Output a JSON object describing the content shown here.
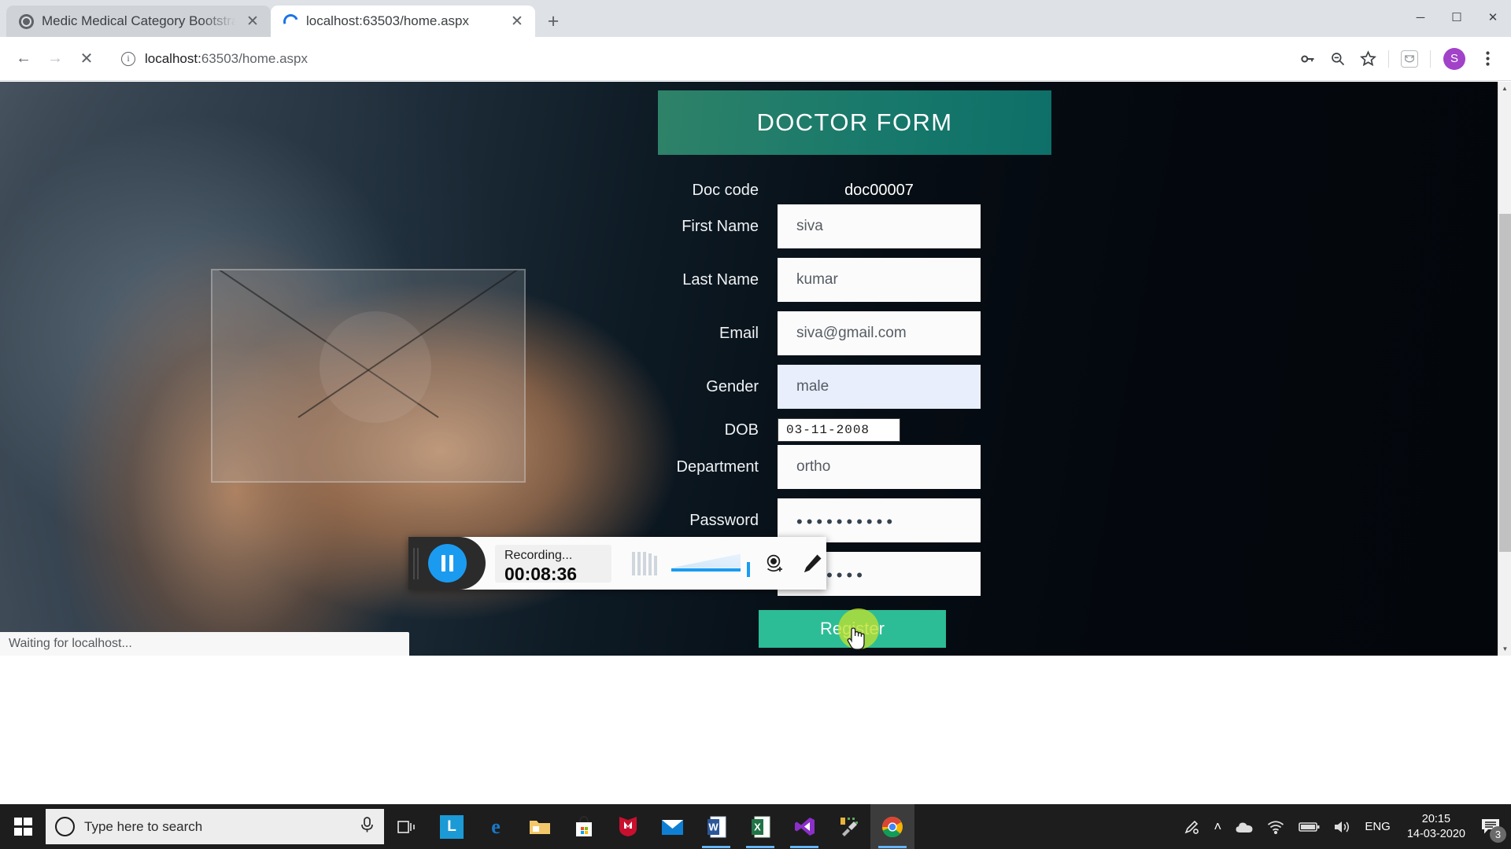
{
  "browser": {
    "tabs": [
      {
        "title": "Medic Medical Category Bootstra",
        "favicon": "globe-icon",
        "active": false,
        "close_label": "✕"
      },
      {
        "title": "localhost:63503/home.aspx",
        "favicon": "loading-spinner-icon",
        "active": true,
        "close_label": "✕"
      }
    ],
    "new_tab_label": "+",
    "window_controls": {
      "minimize": "─",
      "maximize": "☐",
      "close": "✕"
    },
    "nav": {
      "back": "←",
      "forward": "→",
      "stop": "✕"
    },
    "omnibox": {
      "scheme_prefix": "localhost:",
      "url_rest": "63503/home.aspx",
      "full_url": "localhost:63503/home.aspx",
      "info_icon_label": "i"
    },
    "toolbar_icons": [
      "key-icon",
      "zoom-out-icon",
      "star-bookmark-icon",
      "extension-icon",
      "profile-avatar",
      "three-dot-menu-icon"
    ],
    "profile_initial": "S"
  },
  "page": {
    "form": {
      "title": "DOCTOR FORM",
      "rows": [
        {
          "label": "Doc code",
          "type": "static",
          "value": "doc00007"
        },
        {
          "label": "First Name",
          "type": "text",
          "value": "siva"
        },
        {
          "label": "Last Name",
          "type": "text",
          "value": "kumar"
        },
        {
          "label": "Email",
          "type": "text",
          "value": "siva@gmail.com"
        },
        {
          "label": "Gender",
          "type": "autofill",
          "value": "male"
        },
        {
          "label": "DOB",
          "type": "date",
          "value": "03-11-2008"
        },
        {
          "label": "Department",
          "type": "text",
          "value": "ortho"
        },
        {
          "label": "Password",
          "type": "password",
          "value": "••••••••••"
        },
        {
          "label": "",
          "type": "password",
          "value": "•••••••"
        }
      ],
      "submit_label": "Register"
    },
    "colors": {
      "header_green_from": "#2e8268",
      "header_green_to": "#0d6f68",
      "button_green": "#2cbd96",
      "autofill_blue": "#e8eefc",
      "click_flash": "#bee030"
    },
    "status_text": "Waiting for localhost..."
  },
  "recorder": {
    "pause_label": "pause-icon",
    "status_label": "Recording...",
    "elapsed": "00:08:36",
    "icons": [
      "audio-level-bars-icon",
      "volume-slider",
      "webcam-add-icon",
      "pencil-draw-icon"
    ]
  },
  "taskbar": {
    "start_label": "windows-start-icon",
    "search_placeholder": "Type here to search",
    "mic_icon": "microphone-icon",
    "task_view_icon": "task-view-icon",
    "apps": [
      {
        "name": "lightshot-app-icon",
        "glyph": "L",
        "color": "#ffffff",
        "bg": "#1b9ad6",
        "running": false
      },
      {
        "name": "edge-browser-icon",
        "glyph": "e",
        "color": "#0f6cbd",
        "bg": "transparent",
        "running": false
      },
      {
        "name": "file-explorer-icon",
        "glyph": "▤",
        "color": "#f5c24a",
        "bg": "transparent",
        "running": false
      },
      {
        "name": "microsoft-store-icon",
        "glyph": "⊞",
        "color": "#ffffff",
        "bg": "#f3f3f3",
        "running": false
      },
      {
        "name": "mcafee-icon",
        "glyph": "M",
        "color": "#ffffff",
        "bg": "#c8102e",
        "running": false
      },
      {
        "name": "mail-icon",
        "glyph": "✉",
        "color": "#ffffff",
        "bg": "#0f7fd4",
        "running": false
      },
      {
        "name": "word-icon",
        "glyph": "W",
        "color": "#2b579a",
        "bg": "#ffffff",
        "running": true
      },
      {
        "name": "excel-icon",
        "glyph": "X",
        "color": "#217346",
        "bg": "#ffffff",
        "running": true
      },
      {
        "name": "visual-studio-icon",
        "glyph": "∞",
        "color": "#ffffff",
        "bg": "#8b2fc9",
        "running": true
      },
      {
        "name": "dev-tools-icon",
        "glyph": "⚒",
        "color": "#d8d8d8",
        "bg": "transparent",
        "running": false
      },
      {
        "name": "chrome-browser-icon",
        "glyph": "●",
        "color": "#4285f4",
        "bg": "transparent",
        "running": true
      }
    ],
    "tray": {
      "pen_icon": "pen-input-icon",
      "chevron_up": "˄",
      "cloud_icon": "onedrive-cloud-icon",
      "network_icon": "wifi-icon",
      "battery_icon": "battery-icon",
      "volume_icon": "speaker-icon",
      "language": "ENG",
      "time": "20:15",
      "date": "14-03-2020",
      "notification_icon": "action-center-icon",
      "notification_count": "3"
    }
  }
}
